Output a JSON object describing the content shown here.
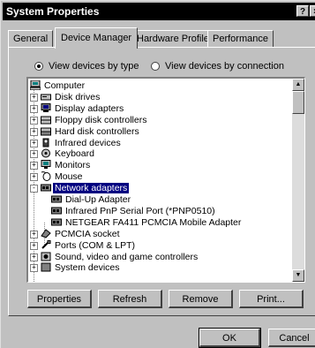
{
  "window": {
    "title": "System Properties",
    "help_label": "?",
    "close_label": "×"
  },
  "tabs": [
    {
      "label": "General",
      "active": false
    },
    {
      "label": "Device Manager",
      "active": true
    },
    {
      "label": "Hardware Profiles",
      "active": false
    },
    {
      "label": "Performance",
      "active": false
    }
  ],
  "view": {
    "by_type_label": "View devices by type",
    "by_connection_label": "View devices by connection",
    "selected": "by_type"
  },
  "tree": [
    {
      "label": "Computer",
      "icon": "computer-icon",
      "level": 0,
      "expander": ""
    },
    {
      "label": "Disk drives",
      "icon": "disk-drive-icon",
      "level": 1,
      "expander": "+"
    },
    {
      "label": "Display adapters",
      "icon": "display-adapter-icon",
      "level": 1,
      "expander": "+"
    },
    {
      "label": "Floppy disk controllers",
      "icon": "floppy-controller-icon",
      "level": 1,
      "expander": "+"
    },
    {
      "label": "Hard disk controllers",
      "icon": "hard-disk-controller-icon",
      "level": 1,
      "expander": "+"
    },
    {
      "label": "Infrared devices",
      "icon": "infrared-icon",
      "level": 1,
      "expander": "+"
    },
    {
      "label": "Keyboard",
      "icon": "keyboard-icon",
      "level": 1,
      "expander": "+"
    },
    {
      "label": "Monitors",
      "icon": "monitor-icon",
      "level": 1,
      "expander": "+"
    },
    {
      "label": "Mouse",
      "icon": "mouse-icon",
      "level": 1,
      "expander": "+"
    },
    {
      "label": "Network adapters",
      "icon": "network-adapter-icon",
      "level": 1,
      "expander": "-",
      "selected": true
    },
    {
      "label": "Dial-Up Adapter",
      "icon": "network-card-icon",
      "level": 2,
      "expander": ""
    },
    {
      "label": "Infrared PnP Serial Port (*PNP0510)",
      "icon": "network-card-icon",
      "level": 2,
      "expander": ""
    },
    {
      "label": "NETGEAR FA411 PCMCIA Mobile Adapter",
      "icon": "network-card-icon",
      "level": 2,
      "expander": ""
    },
    {
      "label": "PCMCIA socket",
      "icon": "pcmcia-icon",
      "level": 1,
      "expander": "+"
    },
    {
      "label": "Ports (COM & LPT)",
      "icon": "port-icon",
      "level": 1,
      "expander": "+"
    },
    {
      "label": "Sound, video and game controllers",
      "icon": "sound-icon",
      "level": 1,
      "expander": "+"
    },
    {
      "label": "System devices",
      "icon": "system-device-icon",
      "level": 1,
      "expander": "+"
    }
  ],
  "buttons": {
    "properties": "Properties",
    "refresh": "Refresh",
    "remove": "Remove",
    "print": "Print...",
    "ok": "OK",
    "cancel": "Cancel"
  }
}
